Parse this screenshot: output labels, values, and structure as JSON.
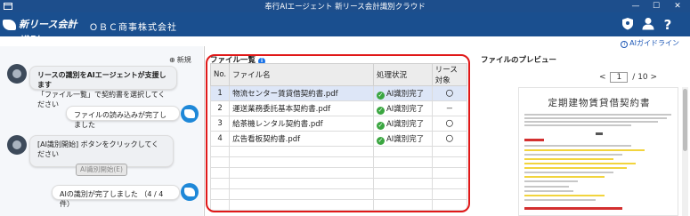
{
  "window": {
    "title": "奉行AIエージェント 新リース会計識別クラウド",
    "controls": [
      "—",
      "☐",
      "✕"
    ]
  },
  "header": {
    "logo_text": "新リース会計識別",
    "company": "ＯＢＣ商事株式会社",
    "icons": [
      "shield-icon",
      "user-icon",
      "help-icon"
    ]
  },
  "guide_link": "AIガイドライン",
  "chat": {
    "new_label": "新規",
    "messages": [
      {
        "from": "bot",
        "line1": "リースの識別をAIエージェントが支援します",
        "line2": "「ファイル一覧」で契約書を選択してください"
      },
      {
        "from": "user",
        "text": "ファイルの読み込みが完了しました"
      },
      {
        "from": "bot",
        "line1": "[AI識別開始] ボタンをクリックしてください",
        "button": "AI識別開始(E)"
      },
      {
        "from": "user",
        "text": "AIの識別が完了しました （4 / 4 件）"
      }
    ]
  },
  "file_list": {
    "title": "ファイル一覧",
    "columns": [
      "No.",
      "ファイル名",
      "処理状況",
      "リース対象"
    ],
    "rows": [
      {
        "no": "1",
        "name": "物流センター賃貸借契約書.pdf",
        "status": "AI識別完了",
        "lease": "〇",
        "selected": true
      },
      {
        "no": "2",
        "name": "運送業務委託基本契約書.pdf",
        "status": "AI識別完了",
        "lease": "－",
        "selected": false
      },
      {
        "no": "3",
        "name": "給茶機レンタル契約書.pdf",
        "status": "AI識別完了",
        "lease": "〇",
        "selected": false
      },
      {
        "no": "4",
        "name": "広告看板契約書.pdf",
        "status": "AI識別完了",
        "lease": "〇",
        "selected": false
      }
    ]
  },
  "preview": {
    "title": "ファイルのプレビュー",
    "page_current": "1",
    "page_total": "/ 10",
    "doc_title": "定期建物賃貸借契約書"
  },
  "colors": {
    "header_bg": "#1a4f8f",
    "highlight": "#e01818",
    "status_ok": "#3aa640",
    "selected_row": "#dde6f7"
  }
}
